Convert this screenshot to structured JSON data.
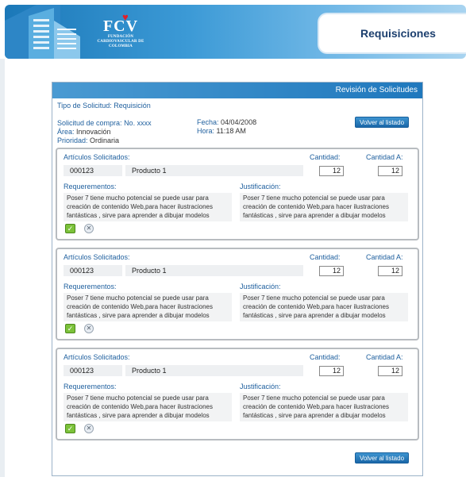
{
  "header": {
    "logo_text": "FCV",
    "logo_subtitle": "FUNDACIÓN CARDIOVASCULAR DE COLOMBIA",
    "page_title": "Requisiciones",
    "colors": {
      "brand": "#1b78b8",
      "title": "#1c3f6e"
    }
  },
  "panel": {
    "heading": "Revisión de Solicitudes",
    "tipo": "Tipo de Solicitud: Requisición",
    "solicitud_label": "Solicitud de compra:",
    "solicitud_value": "No. xxxx",
    "area_label": "Área:",
    "area_value": "Innovación",
    "prioridad_label": "Prioridad:",
    "prioridad_value": "Ordinaria",
    "fecha_label": "Fecha:",
    "fecha_value": "04/04/2008",
    "hora_label": "Hora:",
    "hora_value": "11:18 AM",
    "back_button": "Volver al listado"
  },
  "items": [
    {
      "articulos_label": "Artículos Solicitados:",
      "code": "000123",
      "product": "Producto 1",
      "cantidad_label": "Cantidad:",
      "cantidad": "12",
      "cantidad_a_label": "Cantidad A:",
      "cantidad_a": "12",
      "requerimientos_label": "Requerementos:",
      "requerimientos": "Poser 7 tiene mucho potencial se puede usar para creación de contenido Web,para hacer ilustraciones fantásticas , sirve para aprender a dibujar modelos humanos, lo podéis",
      "justificacion_label": "Justificación:",
      "justificacion": "Poser 7 tiene mucho potencial se puede usar para creación de contenido Web,para hacer ilustraciones fantásticas , sirve para aprender a dibujar modelos humanos, lo podéis"
    },
    {
      "articulos_label": "Artículos Solicitados:",
      "code": "000123",
      "product": "Producto 1",
      "cantidad_label": "Cantidad:",
      "cantidad": "12",
      "cantidad_a_label": "Cantidad A:",
      "cantidad_a": "12",
      "requerimientos_label": "Requerementos:",
      "requerimientos": "Poser 7 tiene mucho potencial se puede usar para creación de contenido Web,para hacer ilustraciones fantásticas , sirve para aprender a dibujar modelos humanos, lo podéis",
      "justificacion_label": "Justificación:",
      "justificacion": "Poser 7 tiene mucho potencial se puede usar para creación de contenido Web,para hacer ilustraciones fantásticas , sirve para aprender a dibujar modelos humanos, lo podéis"
    },
    {
      "articulos_label": "Artículos Solicitados:",
      "code": "000123",
      "product": "Producto 1",
      "cantidad_label": "Cantidad:",
      "cantidad": "12",
      "cantidad_a_label": "Cantidad A:",
      "cantidad_a": "12",
      "requerimientos_label": "Requerementos:",
      "requerimientos": "Poser 7 tiene mucho potencial se puede usar para creación de contenido Web,para hacer ilustraciones fantásticas , sirve para aprender a dibujar modelos humanos, lo podéis",
      "justificacion_label": "Justificación:",
      "justificacion": "Poser 7 tiene mucho potencial se puede usar para creación de contenido Web,para hacer ilustraciones fantásticas , sirve para aprender a dibujar modelos humanos, lo podéis"
    }
  ]
}
